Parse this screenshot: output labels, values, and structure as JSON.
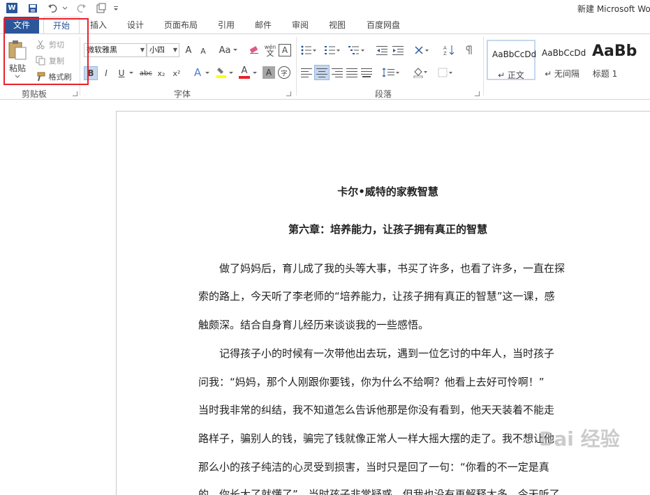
{
  "title_bar": {
    "title": "新建 Microsoft Wo",
    "logo": "W"
  },
  "tabs": [
    {
      "label": "文件"
    },
    {
      "label": "开始"
    },
    {
      "label": "插入"
    },
    {
      "label": "设计"
    },
    {
      "label": "页面布局"
    },
    {
      "label": "引用"
    },
    {
      "label": "邮件"
    },
    {
      "label": "审阅"
    },
    {
      "label": "视图"
    },
    {
      "label": "百度网盘"
    }
  ],
  "clipboard": {
    "paste": "粘贴",
    "cut": "剪切",
    "copy": "复制",
    "format_painter": "格式刷",
    "group_label": "剪贴板"
  },
  "font": {
    "font_name": "微软雅黑",
    "font_size": "小四",
    "group_label": "字体",
    "change_case": "Aa",
    "bold": "B",
    "italic": "I",
    "underline": "U",
    "strike": "abc",
    "subscript": "x₂",
    "superscript": "x²",
    "wen": "wén",
    "wen_char": "文",
    "a_char": "A",
    "circle_char": "字"
  },
  "paragraph": {
    "group_label": "段落"
  },
  "styles": [
    {
      "sample": "AaBbCcDd",
      "name": "↵ 正文"
    },
    {
      "sample": "AaBbCcDd",
      "name": "↵ 无间隔"
    },
    {
      "sample": "AaBb",
      "name": "标题 1"
    }
  ],
  "document": {
    "title": "卡尔•威特的家教智慧",
    "subtitle": "第六章：培养能力，让孩子拥有真正的智慧",
    "lines": [
      "　　做了妈妈后，育儿成了我的头等大事，书买了许多，也看了许多，一直在探",
      "索的路上，今天听了李老师的“培养能力，让孩子拥有真正的智慧”这一课，感",
      "触颇深。结合自身育儿经历来谈谈我的一些感悟。",
      "　　记得孩子小的时候有一次带他出去玩，遇到一位乞讨的中年人，当时孩子",
      "问我：“妈妈，那个人刚跟你要钱，你为什么不给啊？他看上去好可怜啊！”",
      "当时我非常的纠结，我不知道怎么告诉他那是你没有看到，他天天装着不能走",
      "路样子，骗别人的钱，骗完了钱就像正常人一样大摇大摆的走了。我不想让他",
      "那么小的孩子纯洁的心灵受到损害，当时只是回了一句：“你看的不一定是真",
      "的，你长大了就懂了”。当时孩子非常疑惑，但我也没有再解释太多。今天听了"
    ]
  },
  "watermark": "Bai 经验",
  "colors": {
    "accent": "#2b579a",
    "highlight_box": "#e8212a",
    "font_color_bar": "#e8212a",
    "highlight_bar": "#ffff00"
  }
}
